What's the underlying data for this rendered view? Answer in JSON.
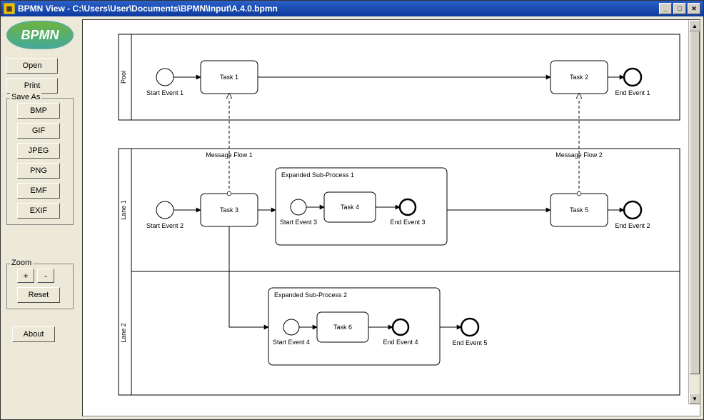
{
  "window": {
    "title": "BPMN View - C:\\Users\\User\\Documents\\BPMN\\Input\\A.4.0.bpmn"
  },
  "logo": {
    "text": "BPMN"
  },
  "buttons": {
    "open": "Open",
    "print": "Print",
    "about": "About"
  },
  "saveas": {
    "legend": "Save As",
    "bmp": "BMP",
    "gif": "GIF",
    "jpeg": "JPEG",
    "png": "PNG",
    "emf": "EMF",
    "exif": "EXIF"
  },
  "zoom": {
    "legend": "Zoom",
    "in": "+",
    "out": "-",
    "reset": "Reset"
  },
  "diagram": {
    "pool1": {
      "name": "Pool"
    },
    "pool2lane1": {
      "name": "Lane 1"
    },
    "pool2lane2": {
      "name": "Lane 2"
    },
    "start1": "Start Event 1",
    "start2": "Start Event 2",
    "start3": "Start Event 3",
    "start4": "Start Event 4",
    "end1": "End Event 1",
    "end2": "End Event 2",
    "end3": "End Event 3",
    "end4": "End Event 4",
    "end5": "End Event 5",
    "task1": "Task 1",
    "task2": "Task 2",
    "task3": "Task 3",
    "task4": "Task 4",
    "task5": "Task 5",
    "task6": "Task 6",
    "sub1": "Expanded Sub-Process 1",
    "sub2": "Expanded Sub-Process 2",
    "msg1": "Message Flow 1",
    "msg2": "Message Flow 2"
  }
}
